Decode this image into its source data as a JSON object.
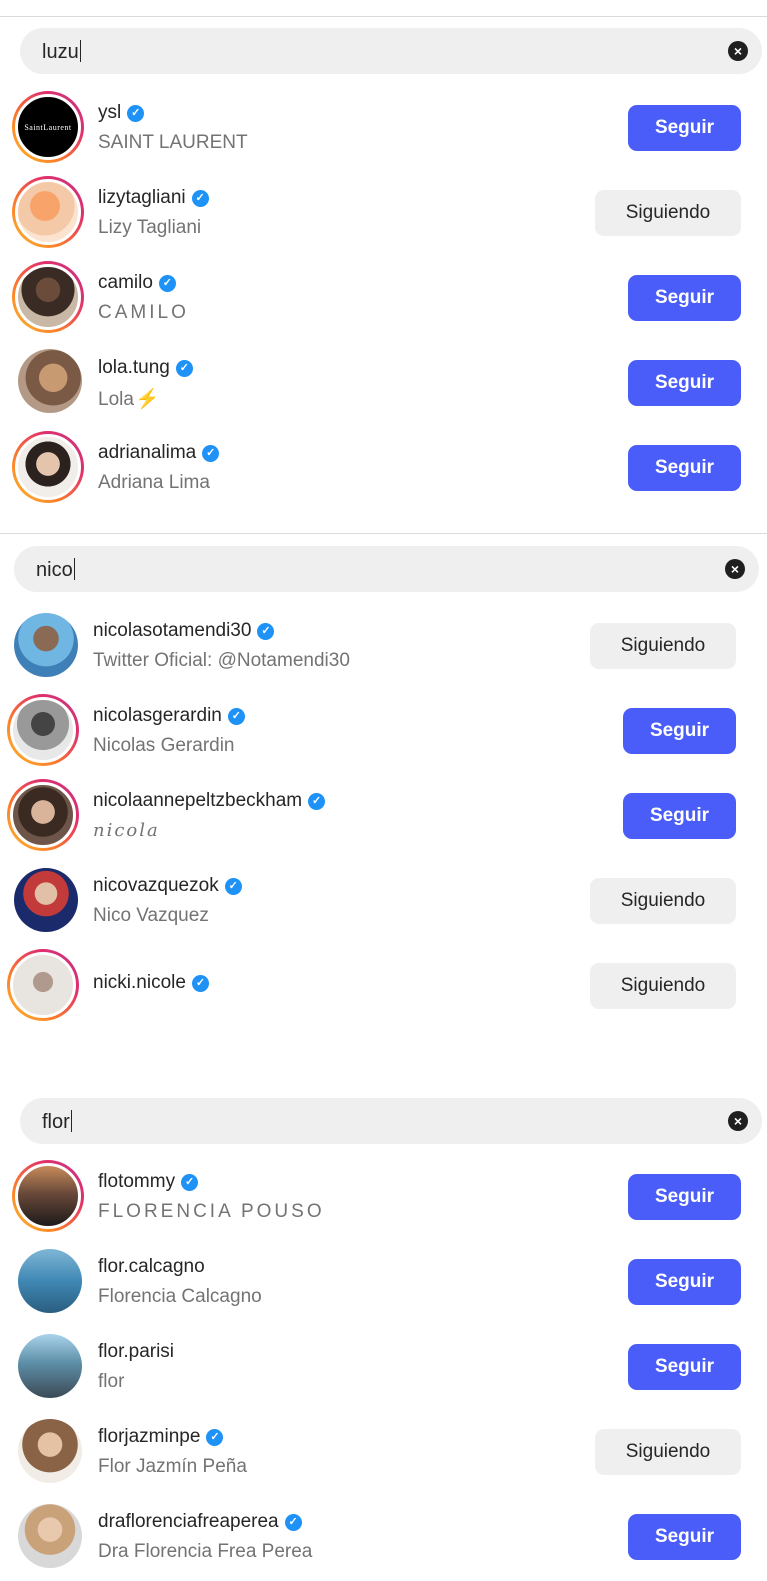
{
  "panels": [
    {
      "query": "luzu",
      "results": [
        {
          "username": "ysl",
          "verified": true,
          "subtitle": "SAINT LAURENT",
          "button": "Seguir",
          "avatar_text": "SaintLaurent"
        },
        {
          "username": "lizytagliani",
          "verified": true,
          "subtitle": "Lizy Tagliani",
          "button": "Siguiendo"
        },
        {
          "username": "camilo",
          "verified": true,
          "subtitle": "CAMILO",
          "button": "Seguir"
        },
        {
          "username": "lola.tung",
          "verified": true,
          "subtitle": "Lola",
          "button": "Seguir"
        },
        {
          "username": "adrianalima",
          "verified": true,
          "subtitle": "Adriana Lima",
          "button": "Seguir"
        }
      ]
    },
    {
      "query": "nico",
      "results": [
        {
          "username": "nicolasotamendi30",
          "verified": true,
          "subtitle": "Twitter Oficial: @Notamendi30",
          "button": "Siguiendo"
        },
        {
          "username": "nicolasgerardin",
          "verified": true,
          "subtitle": "Nicolas Gerardin",
          "button": "Seguir"
        },
        {
          "username": "nicolaannepeltzbeckham",
          "verified": true,
          "subtitle": "nicola",
          "button": "Seguir"
        },
        {
          "username": "nicovazquezok",
          "verified": true,
          "subtitle": "Nico Vazquez",
          "button": "Siguiendo"
        },
        {
          "username": "nicki.nicole",
          "verified": true,
          "subtitle": "",
          "button": "Siguiendo"
        }
      ]
    },
    {
      "query": "flor",
      "results": [
        {
          "username": "flotommy",
          "verified": true,
          "subtitle": "FLORENCIA POUSO",
          "button": "Seguir"
        },
        {
          "username": "flor.calcagno",
          "verified": false,
          "subtitle": "Florencia Calcagno",
          "button": "Seguir"
        },
        {
          "username": "flor.parisi",
          "verified": false,
          "subtitle": "flor",
          "button": "Seguir"
        },
        {
          "username": "florjazminpe",
          "verified": true,
          "subtitle": "Flor Jazmín Peña",
          "button": "Siguiendo"
        },
        {
          "username": "draflorenciafreaperea",
          "verified": true,
          "subtitle": "Dra Florencia Frea Perea",
          "button": "Seguir"
        }
      ]
    }
  ],
  "icons": {
    "clear": "clear-search-icon",
    "verified": "verified-badge-icon",
    "bolt": "lightning-bolt-icon"
  },
  "colors": {
    "follow_button": "#4a5df9",
    "following_button": "#efefef",
    "verified": "#1e92f6",
    "search_bg": "#efefef"
  }
}
